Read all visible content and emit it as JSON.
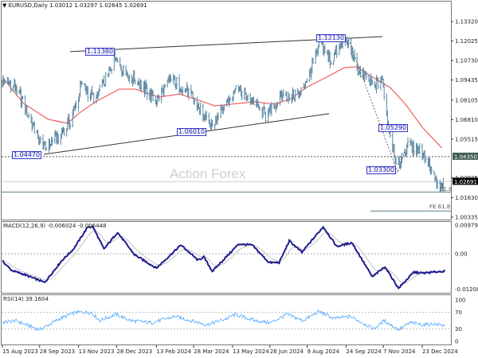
{
  "header": {
    "icon": "triangle-down-icon",
    "symbol": "EURUSD,Daily",
    "ohlc": "1.03012 1.03297 1.02645 1.02691"
  },
  "watermark": "Action Forex",
  "colors": {
    "bars": "#5b87a2",
    "ma": "#f04040",
    "macd": "#1c1c8c",
    "signal": "#c4c4c4",
    "rsi": "#4da6ff",
    "label": "#3a3ac8",
    "level": "#5d7f8e"
  },
  "chart_data": [
    {
      "type": "ohlc",
      "title": "EURUSD,Daily",
      "ylim": [
        1.00335,
        1.1332
      ],
      "y_ticks": [
        "1.13320",
        "1.12025",
        "1.10730",
        "1.09435",
        "1.08105",
        "1.06810",
        "1.05515",
        "1.02935",
        "1.01630",
        "1.00335"
      ],
      "highlight_ticks": {
        "level": "1.04350",
        "last": "1.02691"
      },
      "x_ticks": [
        {
          "date": "2023-08-15",
          "label": "15 Aug 2023"
        },
        {
          "date": "2023-09-28",
          "label": "28 Sep 2023"
        },
        {
          "date": "2023-11-13",
          "label": "13 Nov 2023"
        },
        {
          "date": "2023-12-28",
          "label": "28 Dec 2023"
        },
        {
          "date": "2024-02-13",
          "label": "13 Feb 2024"
        },
        {
          "date": "2024-03-28",
          "label": "28 Mar 2024"
        },
        {
          "date": "2024-05-13",
          "label": "13 May 2024"
        },
        {
          "date": "2024-06-26",
          "label": "26 Jun 2024"
        },
        {
          "date": "2024-08-09",
          "label": "9 Aug 2024"
        },
        {
          "date": "2024-09-24",
          "label": "24 Sep 2024"
        },
        {
          "date": "2024-11-07",
          "label": "7 Nov 2024"
        },
        {
          "date": "2024-12-23",
          "label": "23 Dec 2024"
        }
      ],
      "close_path": [
        [
          "2023-08-15",
          1.0936
        ],
        [
          "2023-08-31",
          1.0899
        ],
        [
          "2023-09-14",
          1.0714
        ],
        [
          "2023-10-03",
          1.048
        ],
        [
          "2023-10-22",
          1.0582
        ],
        [
          "2023-11-05",
          1.0687
        ],
        [
          "2023-11-16",
          1.0909
        ],
        [
          "2023-12-03",
          1.0819
        ],
        [
          "2023-12-17",
          1.0962
        ],
        [
          "2023-12-28",
          1.1121
        ],
        [
          "2024-01-05",
          1.0994
        ],
        [
          "2024-01-24",
          1.0925
        ],
        [
          "2024-02-12",
          1.0804
        ],
        [
          "2024-03-01",
          1.0951
        ],
        [
          "2024-03-20",
          1.0872
        ],
        [
          "2024-04-03",
          1.0767
        ],
        [
          "2024-04-15",
          1.0634
        ],
        [
          "2024-05-02",
          1.0751
        ],
        [
          "2024-05-16",
          1.0888
        ],
        [
          "2024-06-04",
          1.0819
        ],
        [
          "2024-06-22",
          1.0698
        ],
        [
          "2024-07-11",
          1.0846
        ],
        [
          "2024-07-30",
          1.0835
        ],
        [
          "2024-08-13",
          1.1004
        ],
        [
          "2024-08-25",
          1.1189
        ],
        [
          "2024-09-06",
          1.1068
        ],
        [
          "2024-09-17",
          1.1173
        ],
        [
          "2024-09-27",
          1.1189
        ],
        [
          "2024-10-09",
          1.1004
        ],
        [
          "2024-10-27",
          1.0909
        ],
        [
          "2024-11-06",
          1.0941
        ],
        [
          "2024-11-13",
          1.0634
        ],
        [
          "2024-11-24",
          1.037
        ],
        [
          "2024-12-06",
          1.05
        ],
        [
          "2024-12-21",
          1.0477
        ],
        [
          "2024-12-28",
          1.0424
        ],
        [
          "2025-01-04",
          1.0318
        ],
        [
          "2025-01-12",
          1.0212
        ],
        [
          "2025-01-19",
          1.0269
        ]
      ],
      "moving_average": [
        [
          "2023-08-15",
          1.0962
        ],
        [
          "2023-09-09",
          1.0788
        ],
        [
          "2023-10-08",
          1.0683
        ],
        [
          "2023-10-31",
          1.0656
        ],
        [
          "2023-11-14",
          1.0725
        ],
        [
          "2023-12-03",
          1.0799
        ],
        [
          "2023-12-31",
          1.0883
        ],
        [
          "2024-01-19",
          1.0883
        ],
        [
          "2024-02-16",
          1.083
        ],
        [
          "2024-03-11",
          1.0851
        ],
        [
          "2024-04-03",
          1.0809
        ],
        [
          "2024-04-22",
          1.0772
        ],
        [
          "2024-05-11",
          1.0783
        ],
        [
          "2024-06-08",
          1.0799
        ],
        [
          "2024-07-02",
          1.0783
        ],
        [
          "2024-07-21",
          1.082
        ],
        [
          "2024-08-08",
          1.0894
        ],
        [
          "2024-09-01",
          1.0962
        ],
        [
          "2024-09-22",
          1.1026
        ],
        [
          "2024-10-06",
          1.1031
        ],
        [
          "2024-10-27",
          1.0957
        ],
        [
          "2024-11-15",
          1.0894
        ],
        [
          "2024-12-04",
          1.0778
        ],
        [
          "2024-12-23",
          1.063
        ],
        [
          "2025-01-15",
          1.0493
        ]
      ],
      "price_labels": [
        "1.11380",
        "1.04470",
        "1.06010",
        "1.12130",
        "1.05290",
        "1.03300"
      ],
      "trendlines": [
        {
          "from": [
            "2023-11-03",
            1.1132
          ],
          "to": [
            "2024-11-06",
            1.1232
          ]
        },
        {
          "from": [
            "2023-10-03",
            1.045
          ],
          "to": [
            "2024-09-04",
            1.072
          ]
        }
      ],
      "projection_path": [
        [
          "2024-09-27",
          1.1213
        ],
        [
          "2024-11-24",
          1.033
        ],
        [
          "2024-12-06",
          1.0529
        ]
      ],
      "levels": [
        {
          "price": 1.0435,
          "style": "dashed"
        },
        {
          "price": 1.02691,
          "style": "current"
        },
        {
          "price": 1.02,
          "style": "solid",
          "label": "61.8"
        },
        {
          "price": 1.0074,
          "style": "solid",
          "label": "FE 61.8",
          "from": "2024-10-23"
        }
      ]
    },
    {
      "type": "line",
      "title": "MACD(12,26,9) -0.006024 -0.006448",
      "ylim": [
        -0.012081,
        0.009795
      ],
      "y_ticks": [
        "0.009795",
        "0.00",
        "-0.012081"
      ],
      "macd": [
        [
          "2023-08-15",
          -0.0025
        ],
        [
          "2023-08-26",
          -0.0057
        ],
        [
          "2023-09-10",
          -0.0071
        ],
        [
          "2023-10-04",
          -0.0098
        ],
        [
          "2023-10-24",
          -0.0024
        ],
        [
          "2023-11-07",
          0.0016
        ],
        [
          "2023-11-24",
          0.0092
        ],
        [
          "2023-11-30",
          0.0092
        ],
        [
          "2023-12-13",
          0.0016
        ],
        [
          "2023-12-29",
          0.0073
        ],
        [
          "2024-01-18",
          -0.0003
        ],
        [
          "2024-02-13",
          -0.0049
        ],
        [
          "2024-03-13",
          0.003
        ],
        [
          "2024-04-02",
          -0.0022
        ],
        [
          "2024-04-09",
          -0.0011
        ],
        [
          "2024-04-19",
          -0.006
        ],
        [
          "2024-05-20",
          0.0033
        ],
        [
          "2024-06-05",
          0.003
        ],
        [
          "2024-06-25",
          -0.003
        ],
        [
          "2024-07-07",
          -0.003
        ],
        [
          "2024-07-19",
          0.0044
        ],
        [
          "2024-08-03",
          0.0005
        ],
        [
          "2024-08-10",
          0.003
        ],
        [
          "2024-08-28",
          0.0092
        ],
        [
          "2024-09-13",
          0.0025
        ],
        [
          "2024-10-01",
          0.0038
        ],
        [
          "2024-10-25",
          -0.0079
        ],
        [
          "2024-11-09",
          -0.0044
        ],
        [
          "2024-11-25",
          -0.0118
        ],
        [
          "2024-12-13",
          -0.0063
        ],
        [
          "2024-12-24",
          -0.0066
        ],
        [
          "2025-01-15",
          -0.006
        ]
      ]
    },
    {
      "type": "line",
      "title": "RSI(14) 39.1604",
      "ylim": [
        0,
        100
      ],
      "y_ticks": [
        "100",
        "70",
        "30",
        "0"
      ],
      "levels": [
        70,
        30
      ],
      "rsi": [
        [
          "2023-08-15",
          45
        ],
        [
          "2023-08-30",
          50
        ],
        [
          "2023-09-28",
          28
        ],
        [
          "2023-10-22",
          55
        ],
        [
          "2023-11-10",
          70
        ],
        [
          "2023-11-28",
          70
        ],
        [
          "2023-12-08",
          50
        ],
        [
          "2023-12-27",
          65
        ],
        [
          "2024-01-14",
          50
        ],
        [
          "2024-02-07",
          45
        ],
        [
          "2024-03-06",
          60
        ],
        [
          "2024-04-13",
          40
        ],
        [
          "2024-05-06",
          55
        ],
        [
          "2024-05-16",
          65
        ],
        [
          "2024-06-08",
          50
        ],
        [
          "2024-06-27",
          45
        ],
        [
          "2024-07-16",
          65
        ],
        [
          "2024-08-04",
          50
        ],
        [
          "2024-08-23",
          72
        ],
        [
          "2024-09-10",
          55
        ],
        [
          "2024-09-29",
          60
        ],
        [
          "2024-10-27",
          30
        ],
        [
          "2024-11-08",
          50
        ],
        [
          "2024-11-25",
          28
        ],
        [
          "2024-12-09",
          45
        ],
        [
          "2024-12-23",
          40
        ],
        [
          "2025-01-06",
          42
        ],
        [
          "2025-01-15",
          39.16
        ]
      ]
    }
  ]
}
